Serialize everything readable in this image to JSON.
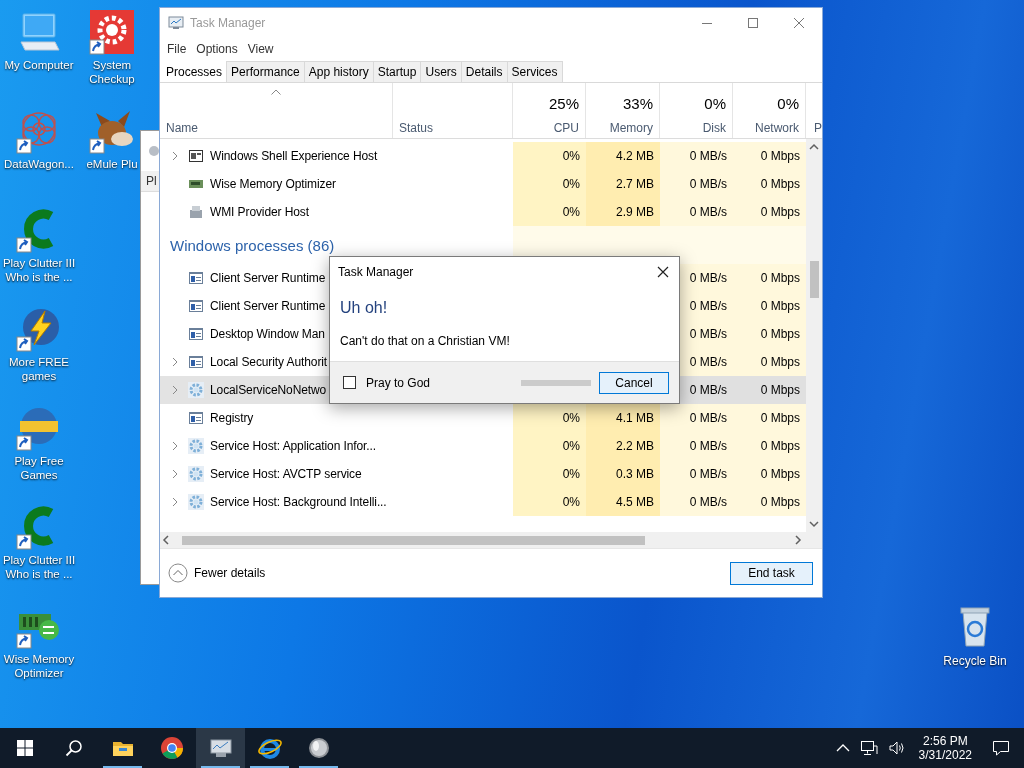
{
  "desktop_icons": [
    {
      "label": "My Computer",
      "kind": "computer",
      "shortcut": false
    },
    {
      "label": "DataWagon...",
      "kind": "datawagon",
      "shortcut": true
    },
    {
      "label": "Play Clutter III Who is the ...",
      "kind": "clutter",
      "shortcut": true
    },
    {
      "label": "More FREE games",
      "kind": "freegames",
      "shortcut": true
    },
    {
      "label": "Play Free Games",
      "kind": "mygames",
      "shortcut": true
    },
    {
      "label": "Play Clutter III Who is the ...",
      "kind": "clutter",
      "shortcut": true
    },
    {
      "label": "Wise Memory Optimizer",
      "kind": "memory",
      "shortcut": true
    },
    {
      "label": "System Checkup",
      "kind": "checkup",
      "shortcut": true
    },
    {
      "label": "eMule Plu",
      "kind": "emule",
      "shortcut": true
    }
  ],
  "recycle_bin": {
    "label": "Recycle Bin"
  },
  "background_window": {
    "text": "Pl"
  },
  "task_manager": {
    "title": "Task Manager",
    "menu": [
      "File",
      "Options",
      "View"
    ],
    "tabs": [
      {
        "label": "Processes",
        "selected": true
      },
      {
        "label": "Performance",
        "selected": false
      },
      {
        "label": "App history",
        "selected": false
      },
      {
        "label": "Startup",
        "selected": false
      },
      {
        "label": "Users",
        "selected": false
      },
      {
        "label": "Details",
        "selected": false
      },
      {
        "label": "Services",
        "selected": false
      }
    ],
    "columns": [
      {
        "label": "Name",
        "sorted": true
      },
      {
        "label": "Status",
        "sorted": false
      },
      {
        "label": "CPU",
        "total": "25%",
        "sorted": false
      },
      {
        "label": "Memory",
        "total": "33%",
        "sorted": false
      },
      {
        "label": "Disk",
        "total": "0%",
        "sorted": false
      },
      {
        "label": "Network",
        "total": "0%",
        "sorted": false
      },
      {
        "label": "P",
        "sorted": false
      }
    ],
    "rows": [
      {
        "kind": "shell",
        "name": "Windows Shell Experience Host",
        "expandable": true,
        "selected": false,
        "cpu": "0%",
        "memory": "4.2 MB",
        "disk": "0 MB/s",
        "network": "0 Mbps"
      },
      {
        "kind": "memory",
        "name": "Wise Memory Optimizer",
        "expandable": false,
        "selected": false,
        "cpu": "0%",
        "memory": "2.7 MB",
        "disk": "0 MB/s",
        "network": "0 Mbps"
      },
      {
        "kind": "wmi",
        "name": "WMI Provider Host",
        "expandable": false,
        "selected": false,
        "cpu": "0%",
        "memory": "2.9 MB",
        "disk": "0 MB/s",
        "network": "0 Mbps"
      },
      {
        "kind": "group",
        "name": "Windows processes (86)"
      },
      {
        "kind": "runtime",
        "name": "Client Server Runtime",
        "expandable": false,
        "selected": false,
        "disk": "0 MB/s",
        "network": "0 Mbps"
      },
      {
        "kind": "runtime",
        "name": "Client Server Runtime",
        "expandable": false,
        "selected": false,
        "disk": "0 MB/s",
        "network": "0 Mbps"
      },
      {
        "kind": "runtime",
        "name": "Desktop Window Man",
        "expandable": false,
        "selected": false,
        "disk": "0 MB/s",
        "network": "0 Mbps"
      },
      {
        "kind": "runtime",
        "name": "Local Security Authorit",
        "expandable": true,
        "selected": false,
        "disk": "0 MB/s",
        "network": "0 Mbps"
      },
      {
        "kind": "service",
        "name": "LocalServiceNoNetwo",
        "expandable": true,
        "selected": true,
        "disk": "0 MB/s",
        "network": "0 Mbps"
      },
      {
        "kind": "runtime",
        "name": "Registry",
        "expandable": false,
        "selected": false,
        "cpu": "0%",
        "memory": "4.1 MB",
        "disk": "0 MB/s",
        "network": "0 Mbps"
      },
      {
        "kind": "service",
        "name": "Service Host: Application Infor...",
        "expandable": true,
        "selected": false,
        "cpu": "0%",
        "memory": "2.2 MB",
        "disk": "0 MB/s",
        "network": "0 Mbps"
      },
      {
        "kind": "service",
        "name": "Service Host: AVCTP service",
        "expandable": true,
        "selected": false,
        "cpu": "0%",
        "memory": "0.3 MB",
        "disk": "0 MB/s",
        "network": "0 Mbps"
      },
      {
        "kind": "service",
        "name": "Service Host: Background Intelli...",
        "expandable": true,
        "selected": false,
        "cpu": "0%",
        "memory": "4.5 MB",
        "disk": "0 MB/s",
        "network": "0 Mbps"
      }
    ],
    "fewer_details": "Fewer details",
    "end_task": "End task"
  },
  "dialog": {
    "title": "Task Manager",
    "heading": "Uh oh!",
    "message": "Can't do that on a Christian VM!",
    "checkbox": {
      "label": "Pray to God",
      "checked": false
    },
    "progress": {
      "level": 1
    },
    "button": "Cancel"
  },
  "taskbar": {
    "pinned": [
      {
        "kind": "explorer",
        "running": true,
        "selected": false
      },
      {
        "kind": "chrome",
        "running": false,
        "selected": false
      },
      {
        "kind": "taskmgr",
        "running": true,
        "selected": true
      },
      {
        "kind": "ie",
        "running": true,
        "selected": false
      },
      {
        "kind": "app",
        "running": true,
        "selected": false
      }
    ],
    "time": "2:56 PM",
    "date": "3/31/2022"
  }
}
